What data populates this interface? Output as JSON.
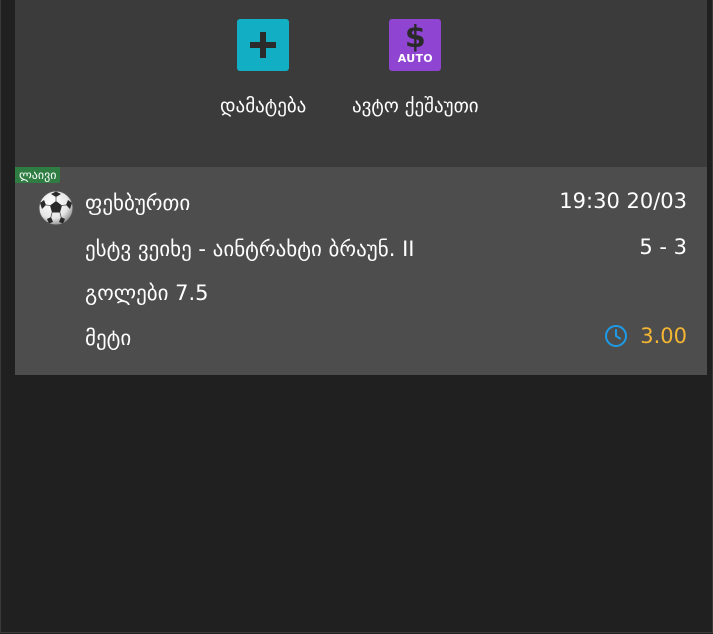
{
  "actions": {
    "add_label": "დამატება",
    "auto_cashout_label": "ავტო ქეშაუთი",
    "auto_icon_symbol": "$",
    "auto_icon_text": "AUTO",
    "add_icon_color": "#12aec4",
    "auto_icon_color": "#8f45d2"
  },
  "bet": {
    "live_badge": "ლაივი",
    "sport_icon": "soccer-ball-icon",
    "league": "ფეხბურთი",
    "datetime": "19:30 20/03",
    "match": "ესტვ ვეიხე - აინტრახტი ბრაუნ. II",
    "score": "5 - 3",
    "market": "გოლები 7.5",
    "selection": "მეტი",
    "odds": "3.00",
    "odds_color": "#f4b533",
    "clock_icon": "clock-icon",
    "clock_color": "#1e9be6",
    "live_color": "#2f7d43"
  }
}
